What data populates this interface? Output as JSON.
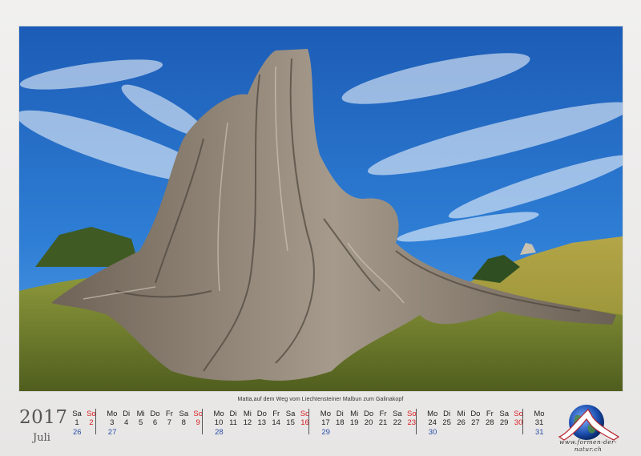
{
  "caption": "Matta,auf dem Weg vom Liechtensteiner Malbun zum Galinakopf",
  "year": "2017",
  "month": "Juli",
  "colors": {
    "sunday": "#d81e22",
    "week": "#2b4fa8",
    "text": "#222222"
  },
  "days": [
    {
      "dow": "Sa",
      "date": "1"
    },
    {
      "dow": "So",
      "date": "2",
      "sunday": true
    },
    {
      "dow": "Mo",
      "date": "3"
    },
    {
      "dow": "Di",
      "date": "4"
    },
    {
      "dow": "Mi",
      "date": "5"
    },
    {
      "dow": "Do",
      "date": "6"
    },
    {
      "dow": "Fr",
      "date": "7"
    },
    {
      "dow": "Sa",
      "date": "8"
    },
    {
      "dow": "So",
      "date": "9",
      "sunday": true
    },
    {
      "dow": "Mo",
      "date": "10"
    },
    {
      "dow": "Di",
      "date": "11"
    },
    {
      "dow": "Mi",
      "date": "12"
    },
    {
      "dow": "Do",
      "date": "13"
    },
    {
      "dow": "Fr",
      "date": "14"
    },
    {
      "dow": "Sa",
      "date": "15"
    },
    {
      "dow": "So",
      "date": "16",
      "sunday": true
    },
    {
      "dow": "Mo",
      "date": "17"
    },
    {
      "dow": "Di",
      "date": "18"
    },
    {
      "dow": "Mi",
      "date": "19"
    },
    {
      "dow": "Do",
      "date": "20"
    },
    {
      "dow": "Fr",
      "date": "21"
    },
    {
      "dow": "Sa",
      "date": "22"
    },
    {
      "dow": "So",
      "date": "23",
      "sunday": true
    },
    {
      "dow": "Mo",
      "date": "24"
    },
    {
      "dow": "Di",
      "date": "25"
    },
    {
      "dow": "Mi",
      "date": "26"
    },
    {
      "dow": "Do",
      "date": "27"
    },
    {
      "dow": "Fr",
      "date": "28"
    },
    {
      "dow": "Sa",
      "date": "29"
    },
    {
      "dow": "So",
      "date": "30",
      "sunday": true
    },
    {
      "dow": "Mo",
      "date": "31"
    }
  ],
  "weeks": [
    "26",
    "27",
    "28",
    "29",
    "30",
    "31"
  ],
  "logo_text": "www.formen-der-natur.ch"
}
